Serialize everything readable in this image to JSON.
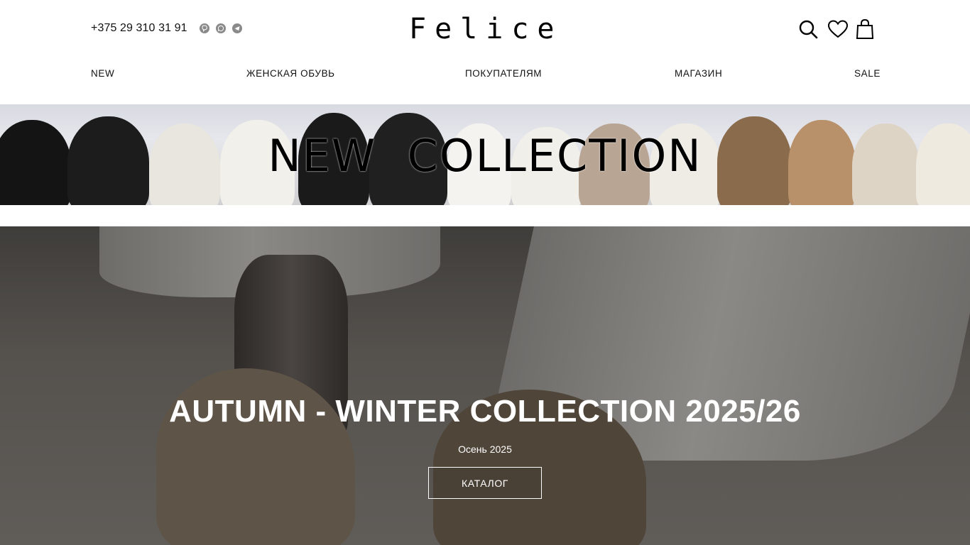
{
  "header": {
    "phone": "+375 29 310 31 91",
    "messengers": [
      "viber-icon",
      "whatsapp-icon",
      "telegram-icon"
    ],
    "logo": "Felice",
    "icons": [
      "search-icon",
      "heart-icon",
      "cart-icon"
    ]
  },
  "nav": {
    "items": [
      {
        "label": "NEW"
      },
      {
        "label": "ЖЕНСКАЯ ОБУВЬ"
      },
      {
        "label": "ПОКУПАТЕЛЯМ"
      },
      {
        "label": "МАГАЗИН"
      },
      {
        "label": "SALE"
      }
    ]
  },
  "banner": {
    "title_word1": "NEW",
    "title_word2": "COLLECTION"
  },
  "hero": {
    "title": "AUTUMN - WINTER COLLECTION 2025/26",
    "subtitle": "Осень 2025",
    "button_label": "КАТАЛОГ"
  },
  "colors": {
    "text": "#111111",
    "hero_text": "#ffffff",
    "icon_grey": "#8a8a8a"
  }
}
